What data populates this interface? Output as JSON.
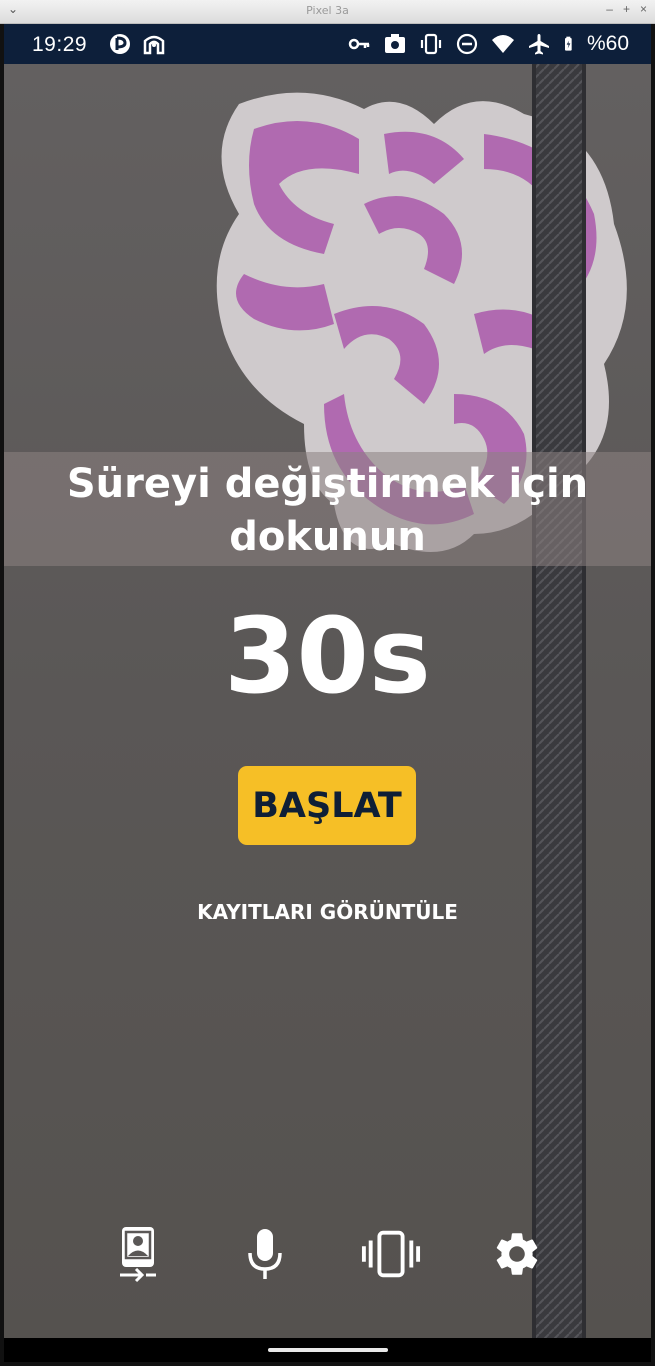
{
  "window": {
    "title": "Pixel 3a",
    "menu_glyph": "⌄",
    "controls": [
      "–",
      "+",
      "×"
    ]
  },
  "status_bar": {
    "time": "19:29",
    "battery_text": "%60",
    "left_icons": [
      "app-notification-icon",
      "accessibility-icon"
    ],
    "right_icons": [
      "key-icon",
      "screenshot-icon",
      "vibrate-icon",
      "do-not-disturb-icon",
      "wifi-icon",
      "airplane-mode-icon",
      "battery-charging-icon"
    ]
  },
  "main": {
    "hint": "Süreyi değiştirmek için dokunun",
    "timer": "30s",
    "start_label": "BAŞLAT",
    "records_label": "KAYITLARI GÖRÜNTÜLE"
  },
  "bottom_bar": {
    "icons": [
      "switch-camera-icon",
      "microphone-icon",
      "vibrate-icon",
      "settings-icon"
    ]
  },
  "colors": {
    "status_bar": "#0d1f3a",
    "accent": "#f6bf26",
    "button_text": "#0f1f36"
  }
}
